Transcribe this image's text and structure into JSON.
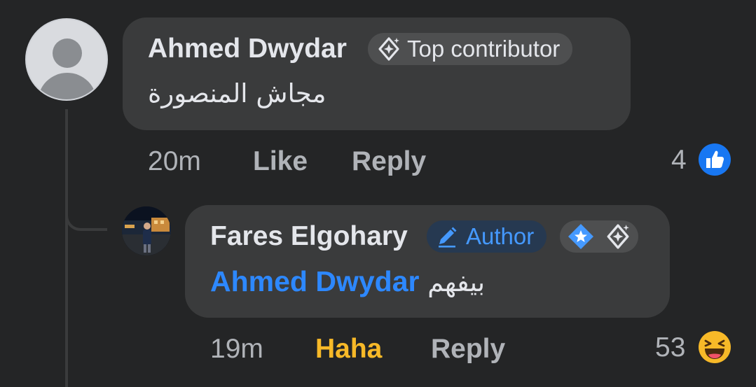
{
  "comment": {
    "author": "Ahmed Dwydar",
    "badge": "Top contributor",
    "text": "مجاش المنصورة",
    "time": "20m",
    "like_label": "Like",
    "reply_label": "Reply",
    "reaction_count": "4",
    "reaction_icon": "like-thumb-icon"
  },
  "reply": {
    "author": "Fares Elgohary",
    "badge": "Author",
    "mention": "Ahmed Dwydar",
    "text": "بيفهم",
    "time": "19m",
    "reaction_label": "Haha",
    "reply_label": "Reply",
    "reaction_count": "53",
    "reaction_icon": "haha-emoji-icon"
  },
  "colors": {
    "background": "#242526",
    "bubble": "#3a3b3c",
    "primary_text": "#e4e6eb",
    "secondary_text": "#b0b3b8",
    "mention": "#2d88ff",
    "author_badge_bg": "#263951",
    "author_badge_text": "#4599ff",
    "haha": "#f7b928",
    "like_blue": "#1877f2"
  }
}
